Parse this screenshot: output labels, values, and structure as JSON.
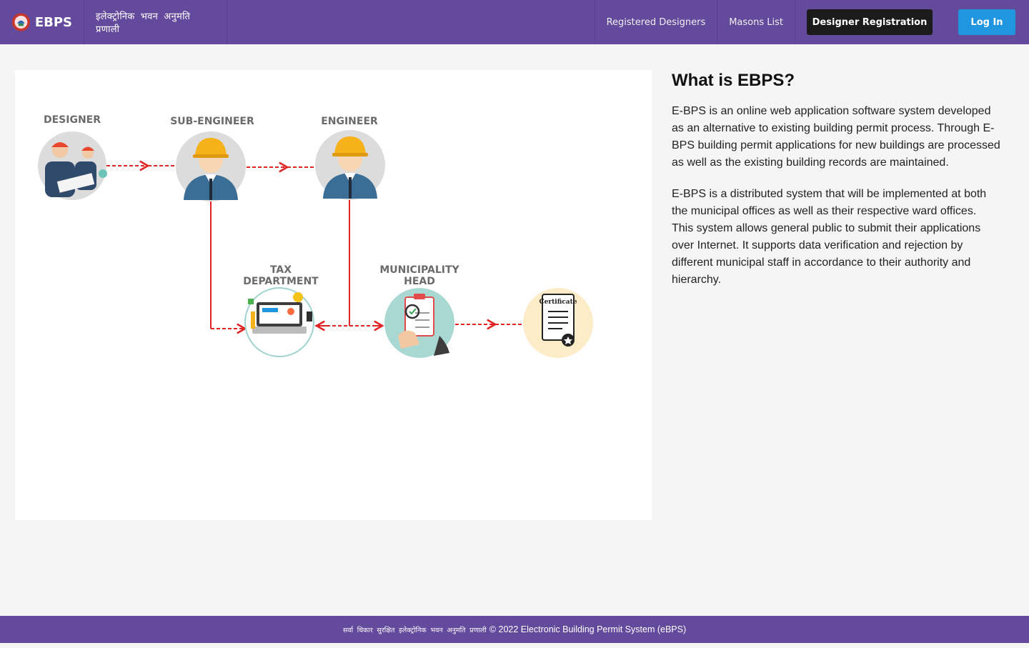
{
  "header": {
    "brand": "EBPS",
    "subtitle": "इलेक्ट्रोनिक भवन अनुमति प्रणाली",
    "nav": [
      {
        "label": "Registered Designers"
      },
      {
        "label": "Masons List"
      }
    ],
    "register_label": "Designer Registration",
    "login_label": "Log In"
  },
  "diagram": {
    "nodes": [
      {
        "label": "DESIGNER",
        "icon": "designers-icon"
      },
      {
        "label": "SUB-ENGINEER",
        "icon": "sub-engineer-icon"
      },
      {
        "label": "ENGINEER",
        "icon": "engineer-icon"
      },
      {
        "label_lines": [
          "TAX",
          "DEPARTMENT"
        ],
        "icon": "laptop-icon"
      },
      {
        "label_lines": [
          "MUNICIPALITY",
          "HEAD"
        ],
        "icon": "clipboard-check-icon"
      },
      {
        "label": "Certificate",
        "icon": "certificate-icon"
      }
    ],
    "colors": {
      "arrow": "#e02424",
      "helmet": "#f6b21a",
      "circle": "#dcdcdc"
    }
  },
  "about": {
    "title": "What is EBPS?",
    "paragraphs": [
      "E-BPS is an online web application software system developed as an alternative to existing building permit process. Through E-BPS building permit applications for new buildings are processed as well as the existing building records are maintained.",
      "E-BPS is a distributed system that will be implemented at both the municipal offices as well as their respective ward offices. This system allows general public to submit their applications over Internet. It supports data verification and rejection by different municipal staff in accordance to their authority and hierarchy."
    ]
  },
  "footer": {
    "nepali": "सर्वा धिकार सुरक्षित इलेक्ट्रोनिक भवन अनुमति प्रणाली",
    "text": "© 2022 Electronic Building Permit System (eBPS)"
  }
}
